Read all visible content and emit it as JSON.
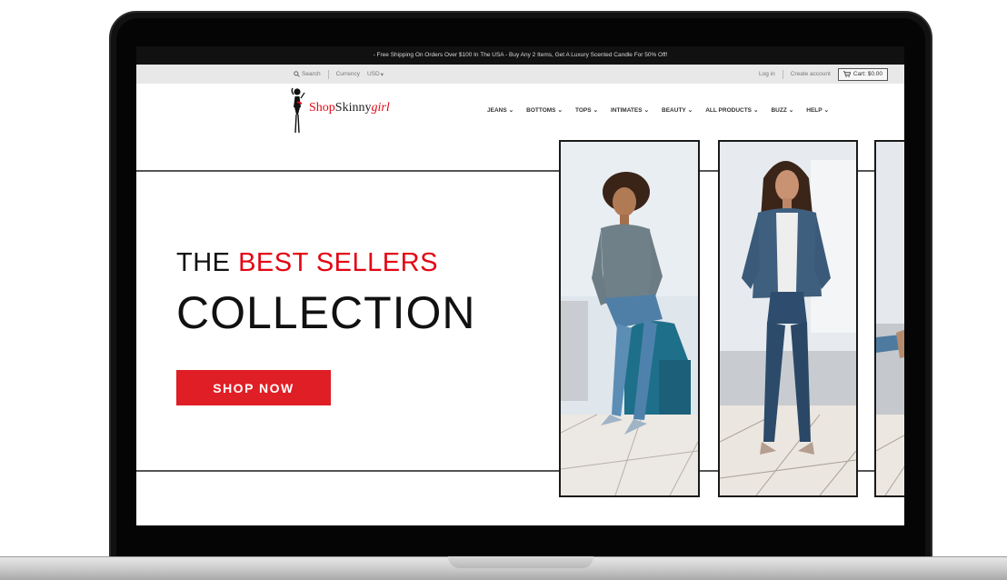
{
  "announcement": "- Free Shipping On Orders Over $100 In The USA - Buy Any 2 Items, Get A Luxury Scented Candle For 50% Off!",
  "utility": {
    "search_label": "Search",
    "currency_label": "Currency",
    "currency_value": "USD",
    "login_label": "Log in",
    "create_account_label": "Create account",
    "cart_label": "Cart: $0.00"
  },
  "logo": {
    "part1": "Shop",
    "part2": "Skinny",
    "part3": "girl"
  },
  "nav": {
    "items": [
      {
        "label": "JEANS"
      },
      {
        "label": "BOTTOMS"
      },
      {
        "label": "TOPS"
      },
      {
        "label": "INTIMATES"
      },
      {
        "label": "BEAUTY"
      },
      {
        "label": "ALL PRODUCTS"
      },
      {
        "label": "BUZZ"
      },
      {
        "label": "HELP"
      }
    ]
  },
  "hero": {
    "headline_part1": "THE",
    "headline_accent": "BEST SELLERS",
    "headline_line2": "COLLECTION",
    "cta_label": "SHOP NOW"
  },
  "colors": {
    "accent": "#e30613",
    "button": "#e01e26",
    "announcement_bg": "#111111",
    "utility_bg": "#e8e8e8"
  },
  "icons": {
    "search": "search-icon",
    "cart": "cart-icon",
    "chevron": "chevron-down-icon"
  }
}
